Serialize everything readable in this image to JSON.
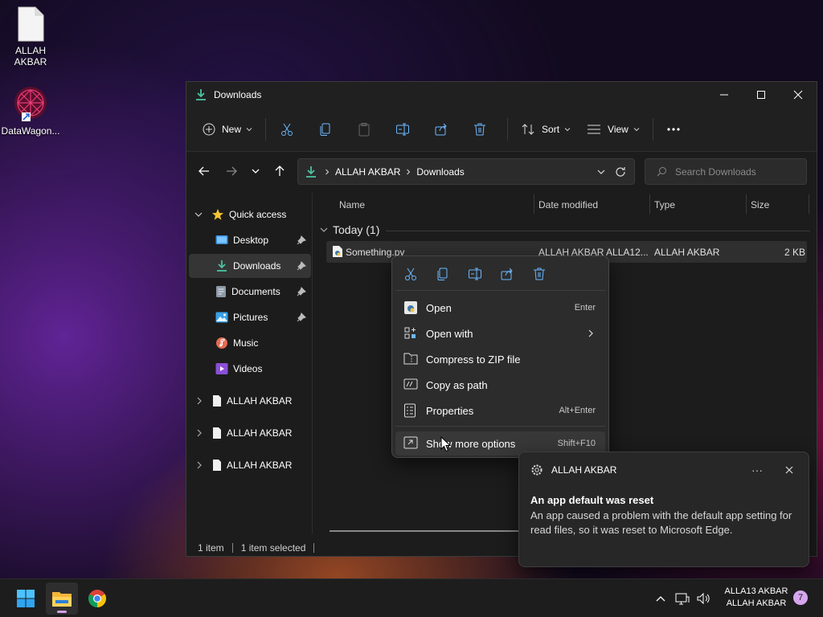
{
  "desktop": {
    "icons": [
      {
        "label": "ALLAH AKBAR",
        "icon": "file-icon"
      },
      {
        "label": "DataWagon...",
        "icon": "app-shortcut-icon"
      }
    ]
  },
  "window": {
    "title": "Downloads",
    "controls": [
      "minimize",
      "maximize",
      "close"
    ]
  },
  "toolbar": {
    "new_label": "New",
    "sort_label": "Sort",
    "view_label": "View"
  },
  "address": {
    "breadcrumbs": [
      "ALLAH AKBAR",
      "Downloads"
    ],
    "search_placeholder": "Search Downloads"
  },
  "sidebar": {
    "quick_access": "Quick access",
    "items": [
      {
        "label": "Desktop",
        "pinned": true
      },
      {
        "label": "Downloads",
        "pinned": true,
        "selected": true
      },
      {
        "label": "Documents",
        "pinned": true
      },
      {
        "label": "Pictures",
        "pinned": true
      },
      {
        "label": "Music",
        "pinned": false
      },
      {
        "label": "Videos",
        "pinned": false
      }
    ],
    "drives": [
      "ALLAH AKBAR",
      "ALLAH AKBAR",
      "ALLAH AKBAR"
    ]
  },
  "columns": {
    "name": "Name",
    "date": "Date modified",
    "type": "Type",
    "size": "Size"
  },
  "group": {
    "label": "Today (1)"
  },
  "file": {
    "name": "Something.py",
    "date": "ALLAH AKBAR ALLA12...",
    "type": "ALLAH AKBAR",
    "size": "2 KB"
  },
  "status": {
    "count": "1 item",
    "selected": "1 item selected"
  },
  "context_menu": {
    "top_actions": [
      "cut-icon",
      "copy-icon",
      "rename-icon",
      "share-icon",
      "delete-icon"
    ],
    "items": [
      {
        "label": "Open",
        "shortcut": "Enter"
      },
      {
        "label": "Open with",
        "shortcut": ""
      },
      {
        "label": "Compress to ZIP file",
        "shortcut": ""
      },
      {
        "label": "Copy as path",
        "shortcut": ""
      },
      {
        "label": "Properties",
        "shortcut": "Alt+Enter"
      },
      {
        "label": "Show more options",
        "shortcut": "Shift+F10"
      }
    ]
  },
  "notification": {
    "app": "ALLAH AKBAR",
    "title": "An app default was reset",
    "body": "An app caused a problem with the default app setting for read files, so it was reset to Microsoft Edge.",
    "more": "···"
  },
  "taskbar": {
    "clock_line1": "ALLA13 AKBAR",
    "clock_line2": "ALLAH AKBAR",
    "notification_count": "7",
    "accent_color": "#d39ee6"
  }
}
